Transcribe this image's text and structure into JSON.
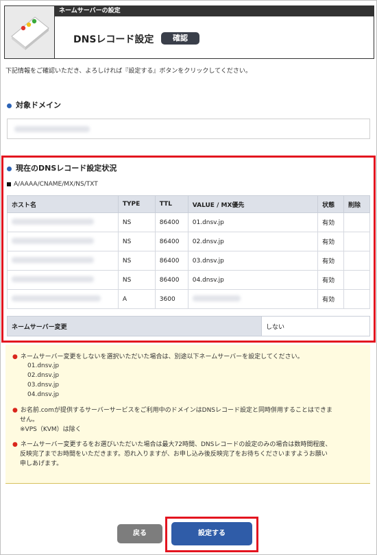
{
  "header": {
    "section_label": "ネームサーバーの設定",
    "title": "DNSレコード設定",
    "badge": "確認"
  },
  "intro_text": "下記情報をご確認いただき、よろしければ『設定する』ボタンをクリックしてください。",
  "domain_section": {
    "title": "対象ドメイン"
  },
  "records_section": {
    "title": "現在のDNSレコード設定状況",
    "subtitle": "A/AAAA/CNAME/MX/NS/TXT",
    "columns": [
      "ホスト名",
      "TYPE",
      "TTL",
      "VALUE / MX優先",
      "状態",
      "削除"
    ],
    "rows": [
      {
        "type": "NS",
        "ttl": "86400",
        "value": "01.dnsv.jp",
        "status": "有効"
      },
      {
        "type": "NS",
        "ttl": "86400",
        "value": "02.dnsv.jp",
        "status": "有効"
      },
      {
        "type": "NS",
        "ttl": "86400",
        "value": "03.dnsv.jp",
        "status": "有効"
      },
      {
        "type": "NS",
        "ttl": "86400",
        "value": "04.dnsv.jp",
        "status": "有効"
      },
      {
        "type": "A",
        "ttl": "3600",
        "value": "",
        "status": "有効"
      }
    ],
    "ns_change_label": "ネームサーバー変更",
    "ns_change_value": "しない"
  },
  "notes": {
    "note1": "ネームサーバー変更をしないを選択いただいた場合は、別途以下ネームサーバーを設定してください。",
    "ns_list": [
      "01.dnsv.jp",
      "02.dnsv.jp",
      "03.dnsv.jp",
      "04.dnsv.jp"
    ],
    "note2_line1": "お名前.comが提供するサーバーサービスをご利用中のドメインはDNSレコード設定と同時併用することはできま",
    "note2_line2": "せん。",
    "note2_line3": "※VPS（KVM）は除く",
    "note3_line1": "ネームサーバー変更するをお選びいただいた場合は最大72時間、DNSレコードの設定のみの場合は数時間程度、",
    "note3_line2": "反映完了までお時間をいただきます。恐れ入りますが、お申し込み後反映完了をお待ちくださいますようお願い",
    "note3_line3": "申しあげます。"
  },
  "buttons": {
    "back": "戻る",
    "submit": "設定する"
  }
}
